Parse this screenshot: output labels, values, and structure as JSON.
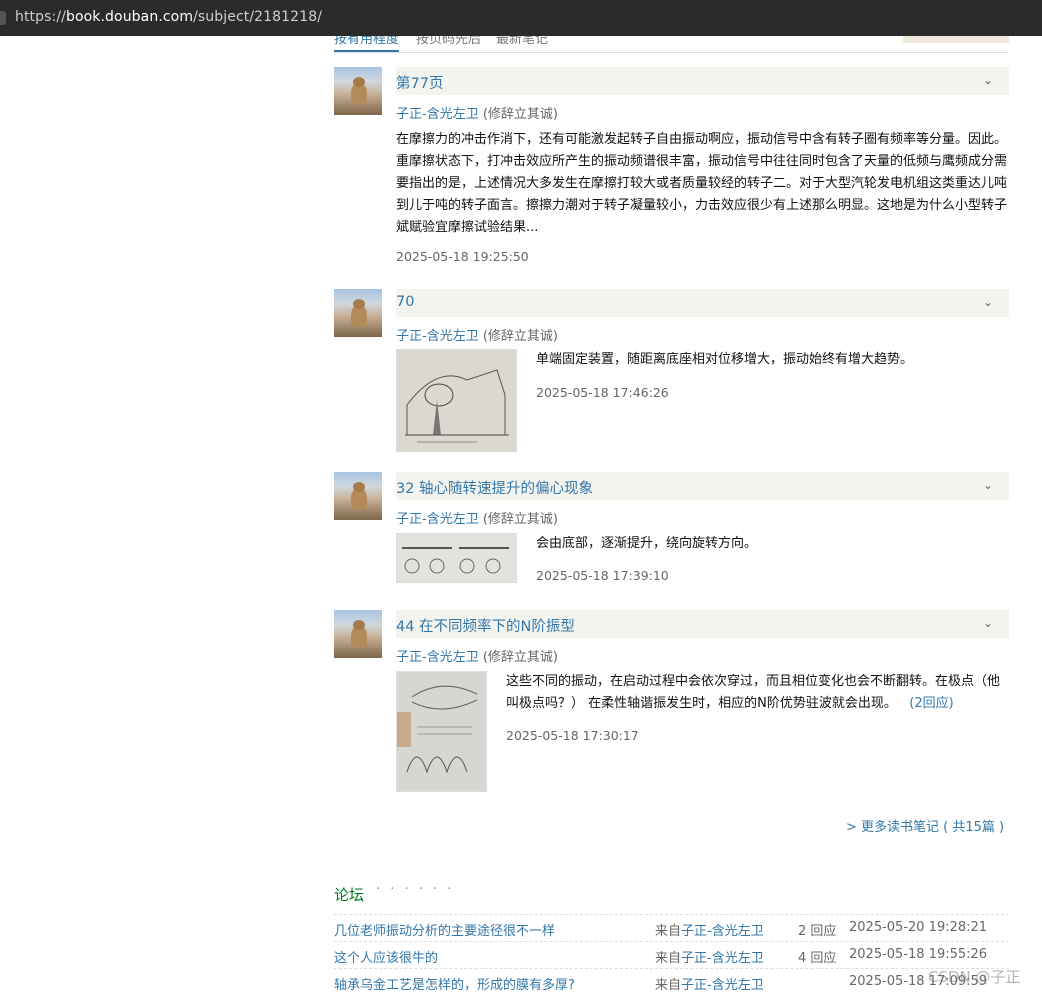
{
  "browser": {
    "url_prefix": "https://",
    "url_domain": "book.douban.com",
    "url_path": "/subject/2181218/"
  },
  "tabs": [
    {
      "label": "按有用程度"
    },
    {
      "label": "按页码先后"
    },
    {
      "label": "最新笔记"
    }
  ],
  "notes": [
    {
      "title": "第77页",
      "author": "子正-含光左卫",
      "tagline": "(修辞立其诚)",
      "body": "在摩擦力的冲击作消下，还有可能激发起转子自由振动啊应，振动信号中含有转子圈有频率等分量。因此。重摩擦状态下，打冲击效应所产生的振动频谱很丰富，振动信号中往往同时包含了天量的低频与鹰频成分需要指出的是，上述情况大多发生在摩擦打较大或者质量较经的转子二。对于大型汽轮发电机组这类重达儿吨到儿于吨的转子面言。擦擦力潮对于转子凝量较小，力击效应很少有上述那么明显。这地是为什么小型转子斌赋验宜摩擦试验结果...",
      "time": "2025-05-18 19:25:50"
    },
    {
      "title": "70",
      "author": "子正-含光左卫",
      "tagline": "(修辞立其诚)",
      "body": "单端固定装置，随距离底座相对位移增大，振动始终有增大趋势。",
      "time": "2025-05-18 17:46:26"
    },
    {
      "title": "32 轴心随转速提升的偏心现象",
      "author": "子正-含光左卫",
      "tagline": "(修辞立其诚)",
      "body": "会由底部，逐渐提升，绕向旋转方向。",
      "time": "2025-05-18 17:39:10"
    },
    {
      "title": "44 在不同频率下的N阶振型",
      "author": "子正-含光左卫",
      "tagline": "(修辞立其诚)",
      "body": "这些不同的振动，在启动过程中会依次穿过，而且相位变化也会不断翻转。在极点（他叫极点吗？） 在柔性轴谐振发生时，相应的N阶优势驻波就会出现。",
      "reply": "(2回应)",
      "time": "2025-05-18 17:30:17"
    }
  ],
  "more_notes": "> 更多读书笔记  ( 共15篇 )",
  "forum": {
    "title": "论坛",
    "dots": "· · · · · ·",
    "rows": [
      {
        "title": "几位老师振动分析的主要途径很不一样",
        "from_prefix": "来自",
        "from_name": "子正-含光左卫",
        "replies": "2 回应",
        "date": "2025-05-20 19:28:21"
      },
      {
        "title": "这个人应该很牛的",
        "from_prefix": "来自",
        "from_name": "子正-含光左卫",
        "replies": "4 回应",
        "date": "2025-05-18 19:55:26"
      },
      {
        "title": "轴承乌金工艺是怎样的，形成的膜有多厚?",
        "from_prefix": "来自",
        "from_name": "子正-含光左卫",
        "replies": "",
        "date": "2025-05-18 17:09:59"
      }
    ]
  },
  "watermark": "CSDN @子正",
  "icons": {
    "collapse": "chevron-down-icon"
  }
}
